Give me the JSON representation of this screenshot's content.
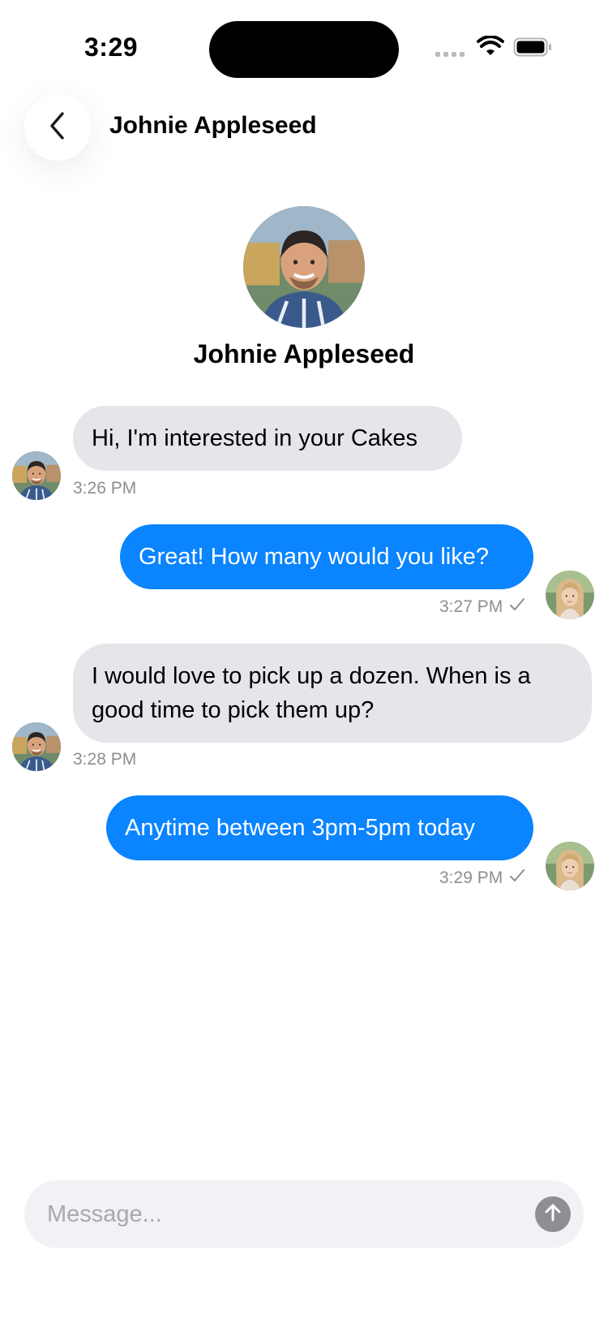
{
  "status_bar": {
    "time": "3:29",
    "signal_icon": "cellular-signal-icon",
    "wifi_icon": "wifi-icon",
    "battery_icon": "battery-icon"
  },
  "header": {
    "back_icon": "chevron-left-icon",
    "title": "Johnie Appleseed"
  },
  "profile": {
    "name": "Johnie Appleseed",
    "avatar_icon": "profile-photo"
  },
  "messages": [
    {
      "direction": "incoming",
      "text": "Hi, I'm interested in your Cakes",
      "time": "3:26 PM"
    },
    {
      "direction": "outgoing",
      "text": "Great! How many would you like?",
      "time": "3:27 PM",
      "status_icon": "checkmark-icon"
    },
    {
      "direction": "incoming",
      "text": "I would love to pick up a dozen. When is a good time to pick them up?",
      "time": "3:28 PM"
    },
    {
      "direction": "outgoing",
      "text": "Anytime between 3pm-5pm today",
      "time": "3:29 PM",
      "status_icon": "checkmark-icon"
    }
  ],
  "composer": {
    "placeholder": "Message...",
    "value": "",
    "send_icon": "arrow-up-icon"
  },
  "colors": {
    "outgoing_bubble": "#0a84ff",
    "incoming_bubble": "#e5e5ea",
    "timestamp": "#8e8e93",
    "composer_bg": "#f1f1f6"
  }
}
